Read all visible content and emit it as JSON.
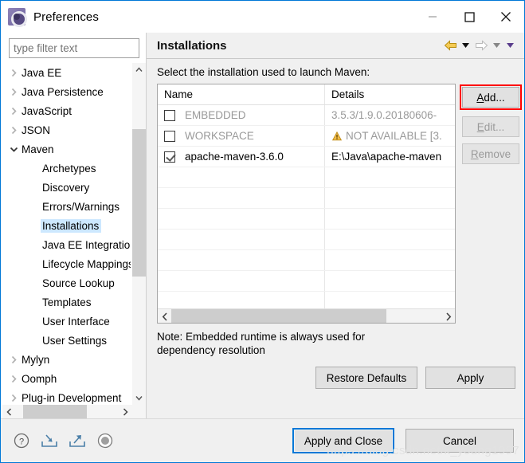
{
  "window": {
    "title": "Preferences",
    "icon": "preferences-gear-icon",
    "controls": {
      "minimize": "minimize-icon",
      "maximize": "maximize-icon",
      "close": "close-icon"
    }
  },
  "sidebar": {
    "filter": {
      "value": "",
      "placeholder": "type filter text"
    },
    "items": [
      {
        "label": "Java EE",
        "indent": 0,
        "twisty": "collapsed",
        "selected": false
      },
      {
        "label": "Java Persistence",
        "indent": 0,
        "twisty": "collapsed",
        "selected": false
      },
      {
        "label": "JavaScript",
        "indent": 0,
        "twisty": "collapsed",
        "selected": false
      },
      {
        "label": "JSON",
        "indent": 0,
        "twisty": "collapsed",
        "selected": false
      },
      {
        "label": "Maven",
        "indent": 0,
        "twisty": "expanded",
        "selected": false
      },
      {
        "label": "Archetypes",
        "indent": 1,
        "twisty": "none",
        "selected": false
      },
      {
        "label": "Discovery",
        "indent": 1,
        "twisty": "none",
        "selected": false
      },
      {
        "label": "Errors/Warnings",
        "indent": 1,
        "twisty": "none",
        "selected": false
      },
      {
        "label": "Installations",
        "indent": 1,
        "twisty": "none",
        "selected": true
      },
      {
        "label": "Java EE Integration",
        "indent": 1,
        "twisty": "none",
        "selected": false
      },
      {
        "label": "Lifecycle Mappings",
        "indent": 1,
        "twisty": "none",
        "selected": false
      },
      {
        "label": "Source Lookup",
        "indent": 1,
        "twisty": "none",
        "selected": false
      },
      {
        "label": "Templates",
        "indent": 1,
        "twisty": "none",
        "selected": false
      },
      {
        "label": "User Interface",
        "indent": 1,
        "twisty": "none",
        "selected": false
      },
      {
        "label": "User Settings",
        "indent": 1,
        "twisty": "none",
        "selected": false
      },
      {
        "label": "Mylyn",
        "indent": 0,
        "twisty": "collapsed",
        "selected": false
      },
      {
        "label": "Oomph",
        "indent": 0,
        "twisty": "collapsed",
        "selected": false
      },
      {
        "label": "Plug-in Development",
        "indent": 0,
        "twisty": "collapsed",
        "selected": false
      }
    ]
  },
  "page": {
    "title": "Installations",
    "nav": {
      "back": "back-arrow-icon",
      "back_menu": "back-dropdown-icon",
      "forward": "forward-arrow-icon",
      "forward_menu": "forward-dropdown-icon",
      "view_menu": "view-menu-dropdown-icon"
    },
    "instruction": "Select the installation used to launch Maven:",
    "table": {
      "columns": [
        "Name",
        "Details"
      ],
      "rows": [
        {
          "checked": false,
          "name": "EMBEDDED",
          "details": "3.5.3/1.9.0.20180606-",
          "dimmed": true,
          "warning": false
        },
        {
          "checked": false,
          "name": "WORKSPACE",
          "details": "NOT AVAILABLE [3.",
          "dimmed": true,
          "warning": true
        },
        {
          "checked": true,
          "name": "apache-maven-3.6.0",
          "details": "E:\\Java\\apache-maven",
          "dimmed": false,
          "warning": false
        }
      ],
      "empty_row_count": 7,
      "hscroll_left": "scroll-left-icon",
      "hscroll_right": "scroll-right-icon"
    },
    "side_buttons": [
      {
        "label": "Add...",
        "mnemonic": "A",
        "enabled": true,
        "highlighted": true
      },
      {
        "label": "Edit...",
        "mnemonic": "E",
        "enabled": false,
        "highlighted": false
      },
      {
        "label": "Remove",
        "mnemonic": "R",
        "enabled": false,
        "highlighted": false
      }
    ],
    "note": "Note: Embedded runtime is always used for dependency resolution",
    "restore_defaults": "Restore Defaults",
    "restore_defaults_mnemonic": "D",
    "apply": "Apply",
    "apply_mnemonic": "A"
  },
  "footer": {
    "icons": [
      "help-question-icon",
      "import-preferences-icon",
      "export-preferences-icon",
      "toggle-circle-icon"
    ],
    "apply_and_close": "Apply and Close",
    "cancel": "Cancel"
  },
  "watermark": "https://blog.csdn.net/k_young1997",
  "colors": {
    "accent": "#0078d7",
    "highlight_box": "#ff0000",
    "selection": "#cde8ff",
    "warning": "#e8a33d"
  }
}
